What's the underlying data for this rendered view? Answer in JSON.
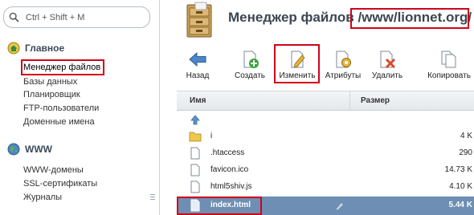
{
  "sidebar": {
    "search_placeholder": "Ctrl + Shift + M",
    "sections": [
      {
        "title": "Главное",
        "icon": "home-icon",
        "items": [
          {
            "label": "Менеджер файлов",
            "active": true
          },
          {
            "label": "Базы данных"
          },
          {
            "label": "Планировщик"
          },
          {
            "label": "FTP-пользователи"
          },
          {
            "label": "Доменные имена"
          }
        ]
      },
      {
        "title": "WWW",
        "icon": "globe-icon",
        "items": [
          {
            "label": "WWW-домены"
          },
          {
            "label": "SSL-сертификаты"
          },
          {
            "label": "Журналы"
          }
        ]
      }
    ]
  },
  "header": {
    "title": "Менеджер файлов",
    "path": "/www/lionnet.org/"
  },
  "toolbar": {
    "buttons": [
      {
        "label": "Назад",
        "icon": "back-arrow-icon"
      },
      {
        "label": "Создать",
        "icon": "new-file-icon"
      },
      {
        "label": "Изменить",
        "icon": "edit-icon"
      },
      {
        "label": "Атрибуты",
        "icon": "attributes-icon"
      },
      {
        "label": "Удалить",
        "icon": "delete-icon"
      },
      {
        "label": "Копировать",
        "icon": "copy-icon"
      }
    ]
  },
  "grid": {
    "columns": {
      "name": "Имя",
      "size": "Размер"
    },
    "rows": [
      {
        "name": "",
        "size": "",
        "type": "parent",
        "icon": "up-arrow-icon"
      },
      {
        "name": "i",
        "size": "4 K",
        "type": "folder",
        "icon": "folder-icon"
      },
      {
        "name": ".htaccess",
        "size": "290",
        "type": "file",
        "icon": "file-icon"
      },
      {
        "name": "favicon.ico",
        "size": "14.73 K",
        "type": "file",
        "icon": "file-icon"
      },
      {
        "name": "html5shiv.js",
        "size": "4.10 K",
        "type": "file",
        "icon": "file-icon"
      },
      {
        "name": "index.html",
        "size": "5.44 K",
        "type": "file",
        "icon": "file-icon",
        "selected": true
      }
    ]
  },
  "colors": {
    "highlight": "#d0021b",
    "selection": "#6e8fb3",
    "title_text": "#3b4652"
  }
}
